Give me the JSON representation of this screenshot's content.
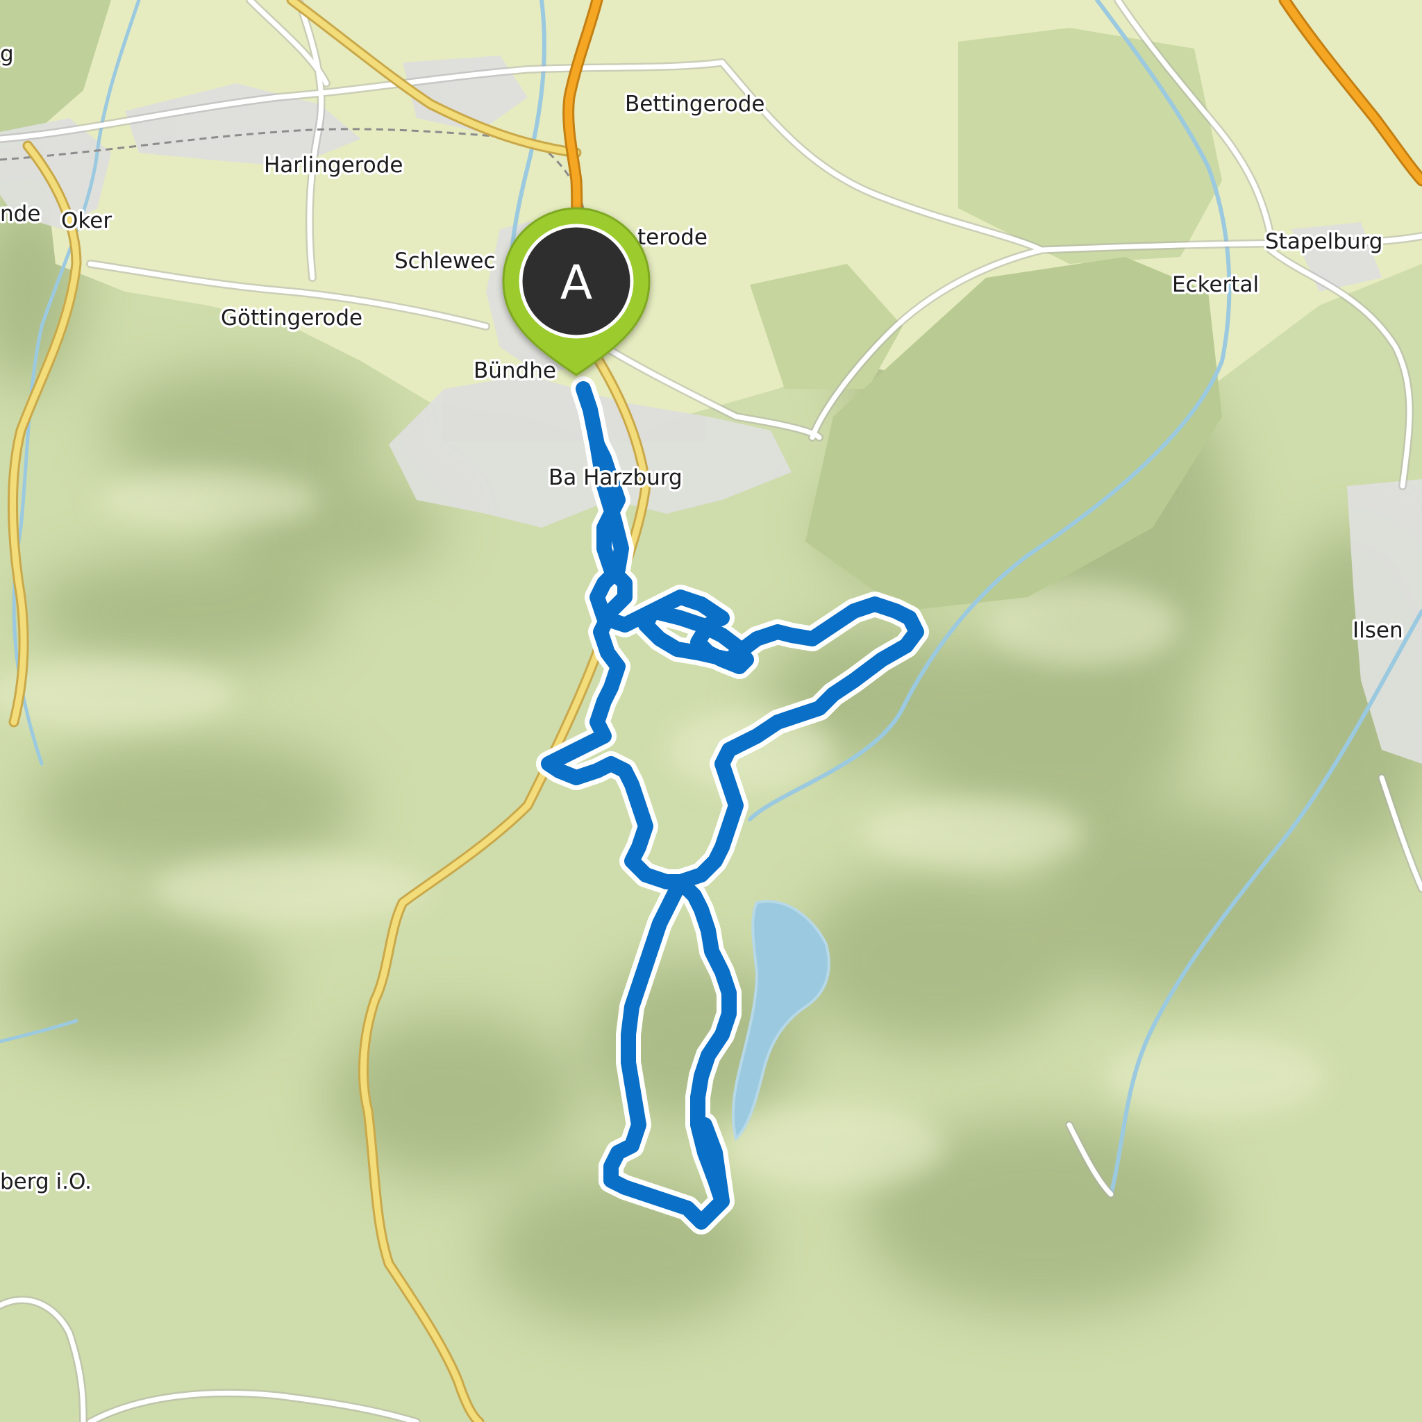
{
  "map": {
    "places": [
      {
        "id": "bettingerode",
        "name": "Bettingerode"
      },
      {
        "id": "harlingerode",
        "name": "Harlingerode"
      },
      {
        "id": "oker",
        "name": "Oker"
      },
      {
        "id": "left-nde",
        "name": "nde"
      },
      {
        "id": "left-g",
        "name": "g"
      },
      {
        "id": "schlewecke",
        "name": "Schlewec"
      },
      {
        "id": "westerode",
        "name": "terode"
      },
      {
        "id": "stapelburg",
        "name": "Stapelburg"
      },
      {
        "id": "eckertal",
        "name": "Eckertal"
      },
      {
        "id": "gottingerode",
        "name": "Göttingerode"
      },
      {
        "id": "bundheim",
        "name": "Bündhe"
      },
      {
        "id": "bad-harzburg",
        "name": "Ba  Harzburg"
      },
      {
        "id": "ilsenburg",
        "name": "Ilsen"
      },
      {
        "id": "altenau",
        "name": "berg i.O."
      }
    ],
    "route": {
      "start_marker_label": "A",
      "color": "#0a6fc6",
      "outline_color": "#ffffff"
    },
    "marker": {
      "pin_color": "#9ccb2e",
      "head_color": "#2f2f2f"
    },
    "colors": {
      "forest": "#cfdcab",
      "forest_dark": "#9fb27c",
      "meadow": "#e6ecc0",
      "settlement": "#dedfdc",
      "water": "#9bc9df",
      "highway": "#f5a623",
      "main_road": "#f3dc7a",
      "minor_road": "#ffffff"
    }
  }
}
